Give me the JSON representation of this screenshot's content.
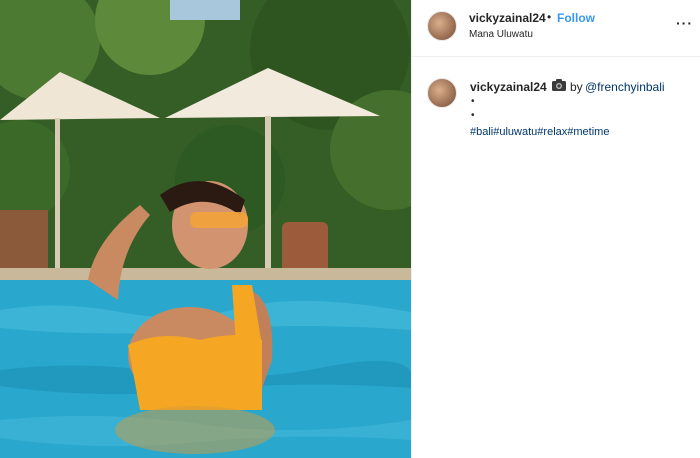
{
  "post": {
    "username": "vickyzainal24",
    "follow_label": "Follow",
    "separator": "•",
    "location": "Mana Uluwatu",
    "more_icon": "more-options-icon",
    "more_glyph": "···"
  },
  "caption": {
    "username": "vickyzainal24",
    "camera_icon": "camera-icon",
    "by_label": "by",
    "mention": "@frenchyinbali",
    "bullets": [
      "•",
      "•"
    ],
    "hashtags": [
      "#bali",
      "#uluwatu",
      "#relax",
      "#metime"
    ]
  },
  "colors": {
    "follow_blue": "#3897f0",
    "link_blue": "#003569",
    "text": "#262626",
    "divider": "#efefef"
  }
}
